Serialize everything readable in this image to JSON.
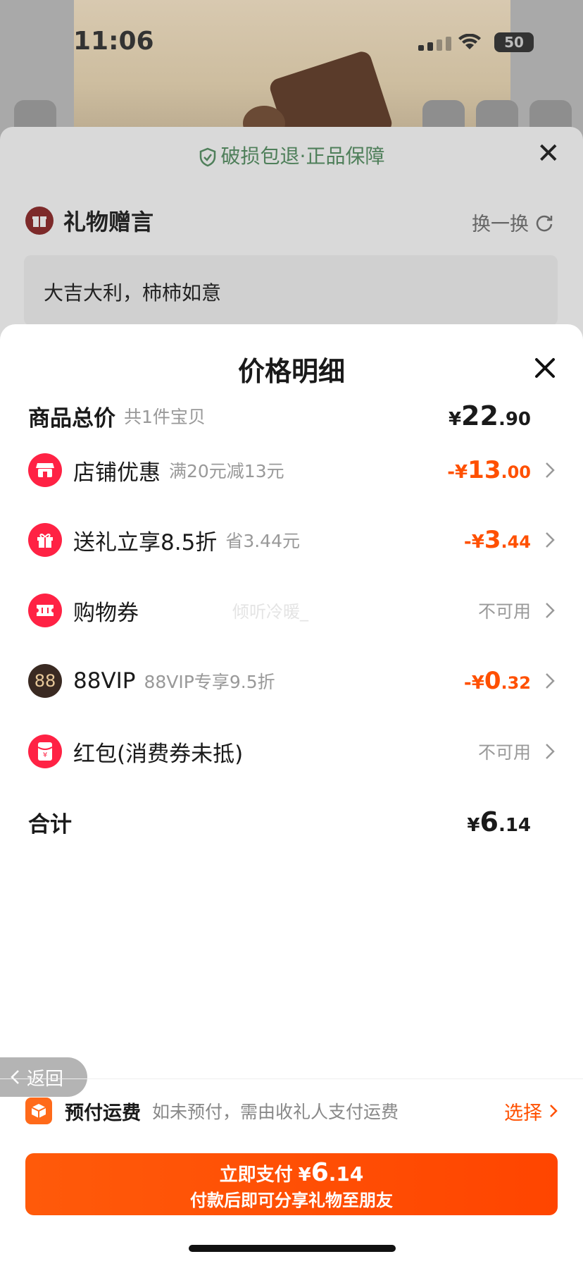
{
  "status_bar": {
    "time": "11:06",
    "battery": "50"
  },
  "background": {
    "guarantee": "破损包退·正品保障",
    "gift_title": "礼物赠言",
    "refresh_label": "换一换",
    "message": "大吉大利，柿柿如意"
  },
  "sheet": {
    "title": "价格明细",
    "rows": [
      {
        "label": "商品总价",
        "sub": "共1件宝贝",
        "yen": "¥",
        "big": "22",
        "small": ".90"
      },
      {
        "label": "店铺优惠",
        "sub": "满20元减13元",
        "yen": "-¥",
        "big": "13",
        "small": ".00"
      },
      {
        "label": "送礼立享8.5折",
        "sub": "省3.44元",
        "yen": "-¥",
        "big": "3",
        "small": ".44"
      },
      {
        "label": "购物券",
        "value": "不可用"
      },
      {
        "label": "88VIP",
        "sub": "88VIP专享9.5折",
        "yen": "-¥",
        "big": "0",
        "small": ".32"
      },
      {
        "label": "红包(消费券未抵)",
        "value": "不可用"
      },
      {
        "label": "合计",
        "yen": "¥",
        "big": "6",
        "small": ".14"
      }
    ],
    "watermark": "倾听冷暖_"
  },
  "back_label": "返回",
  "shipping": {
    "label": "预付运费",
    "hint": "如未预付，需由收礼人支付运费",
    "select": "选择"
  },
  "pay_button": {
    "label": "立即支付",
    "yen": "¥",
    "big": "6",
    "small": ".14",
    "subtitle": "付款后即可分享礼物至朋友"
  },
  "colors": {
    "accent": "#ff5000",
    "icon_red": "#ff2244",
    "vip_dark": "#3a2a22"
  }
}
